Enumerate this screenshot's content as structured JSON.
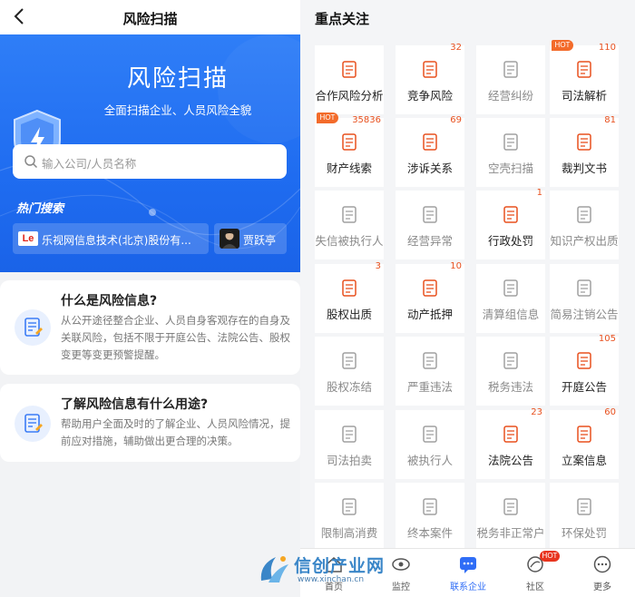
{
  "left": {
    "header_title": "风险扫描",
    "hero_title": "风险扫描",
    "hero_subtitle": "全面扫描企业、人员风险全貌",
    "search_placeholder": "输入公司/人员名称",
    "hot_search_label": "热门搜索",
    "hot_items": [
      {
        "logo_text": "Le",
        "text": "乐视网信息技术(北京)股份有..."
      },
      {
        "text": "贾跃亭"
      }
    ],
    "info_cards": [
      {
        "title": "什么是风险信息?",
        "body": "从公开途径整合企业、人员自身客观存在的自身及关联风险，包括不限于开庭公告、法院公告、股权变更等变更预警提醒。"
      },
      {
        "title": "了解风险信息有什么用途?",
        "body": "帮助用户全面及时的了解企业、人员风险情况，提前应对措施，辅助做出更合理的决策。"
      }
    ]
  },
  "right": {
    "title": "重点关注",
    "grid": [
      {
        "label": "合作风险分析",
        "active": true,
        "count": "",
        "hot": ""
      },
      {
        "label": "竞争风险",
        "active": true,
        "count": "32",
        "hot": ""
      },
      {
        "label": "经营纠纷",
        "active": false,
        "count": "",
        "hot": ""
      },
      {
        "label": "司法解析",
        "active": true,
        "count": "110",
        "hot": "HOT"
      },
      {
        "label": "财产线索",
        "active": true,
        "count": "35836",
        "hot": "HOT"
      },
      {
        "label": "涉诉关系",
        "active": true,
        "count": "69",
        "hot": ""
      },
      {
        "label": "空壳扫描",
        "active": false,
        "count": "",
        "hot": ""
      },
      {
        "label": "裁判文书",
        "active": true,
        "count": "81",
        "hot": ""
      },
      {
        "label": "失信被执行人",
        "active": false,
        "count": "",
        "hot": ""
      },
      {
        "label": "经营异常",
        "active": false,
        "count": "",
        "hot": ""
      },
      {
        "label": "行政处罚",
        "active": true,
        "count": "1",
        "hot": ""
      },
      {
        "label": "知识产权出质",
        "active": false,
        "count": "",
        "hot": ""
      },
      {
        "label": "股权出质",
        "active": true,
        "count": "3",
        "hot": ""
      },
      {
        "label": "动产抵押",
        "active": true,
        "count": "10",
        "hot": ""
      },
      {
        "label": "清算组信息",
        "active": false,
        "count": "",
        "hot": ""
      },
      {
        "label": "简易注销公告",
        "active": false,
        "count": "",
        "hot": ""
      },
      {
        "label": "股权冻结",
        "active": false,
        "count": "",
        "hot": ""
      },
      {
        "label": "严重违法",
        "active": false,
        "count": "",
        "hot": ""
      },
      {
        "label": "税务违法",
        "active": false,
        "count": "",
        "hot": ""
      },
      {
        "label": "开庭公告",
        "active": true,
        "count": "105",
        "hot": ""
      },
      {
        "label": "司法拍卖",
        "active": false,
        "count": "",
        "hot": ""
      },
      {
        "label": "被执行人",
        "active": false,
        "count": "",
        "hot": ""
      },
      {
        "label": "法院公告",
        "active": true,
        "count": "23",
        "hot": ""
      },
      {
        "label": "立案信息",
        "active": true,
        "count": "60",
        "hot": ""
      },
      {
        "label": "限制高消费",
        "active": false,
        "count": "",
        "hot": ""
      },
      {
        "label": "终本案件",
        "active": false,
        "count": "",
        "hot": ""
      },
      {
        "label": "税务非正常户",
        "active": false,
        "count": "",
        "hot": ""
      },
      {
        "label": "环保处罚",
        "active": false,
        "count": "",
        "hot": ""
      }
    ],
    "bottom_nav": [
      {
        "label": "首页",
        "icon": "home-icon"
      },
      {
        "label": "监控",
        "icon": "eye-icon"
      },
      {
        "label": "联系企业",
        "icon": "chat-icon",
        "active": true
      },
      {
        "label": "社区",
        "icon": "community-icon",
        "badge": "HOT"
      },
      {
        "label": "更多",
        "icon": "more-icon"
      }
    ]
  },
  "watermark": {
    "text": "信创产业网",
    "url": "www.xinchan.cn"
  },
  "colors": {
    "brand_blue": "#1f6cf0",
    "accent_red": "#e8511f",
    "hot_orange": "#f36b2a"
  }
}
